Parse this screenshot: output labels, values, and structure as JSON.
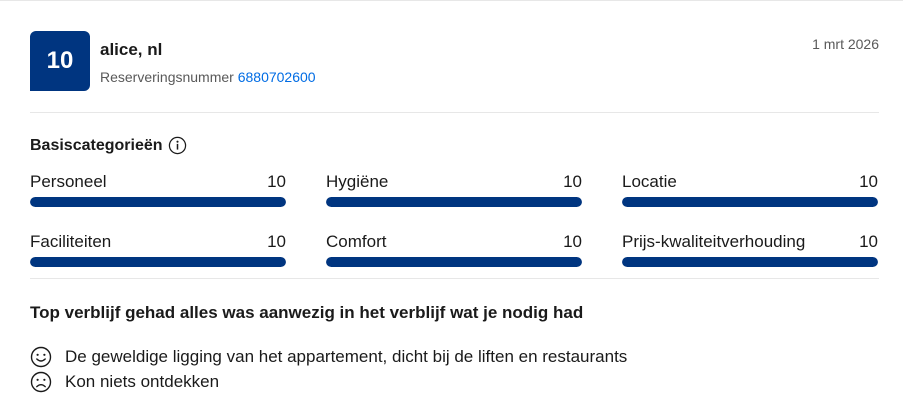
{
  "review": {
    "score": "10",
    "reviewer": "alice, nl",
    "booking_label": "Reserveringsnummer",
    "booking_number": "6880702600",
    "date": "1 mrt 2026"
  },
  "categories": {
    "title": "Basiscategorieën",
    "items": [
      {
        "label": "Personeel",
        "value": "10",
        "score": 10,
        "max": 10
      },
      {
        "label": "Hygiëne",
        "value": "10",
        "score": 10,
        "max": 10
      },
      {
        "label": "Locatie",
        "value": "10",
        "score": 10,
        "max": 10
      },
      {
        "label": "Faciliteiten",
        "value": "10",
        "score": 10,
        "max": 10
      },
      {
        "label": "Comfort",
        "value": "10",
        "score": 10,
        "max": 10
      },
      {
        "label": "Prijs-kwaliteitverhouding",
        "value": "10",
        "score": 10,
        "max": 10
      }
    ]
  },
  "text": {
    "title": "Top verblijf gehad alles was aanwezig in het verblijf wat je nodig had",
    "positive": "De geweldige ligging van het appartement, dicht bij de liften en restaurants",
    "negative": "Kon niets ontdekken"
  },
  "colors": {
    "brand": "#003580",
    "link": "#006ce4"
  },
  "icons": {
    "info": "info-icon",
    "positive": "smile-icon",
    "negative": "frown-icon"
  }
}
